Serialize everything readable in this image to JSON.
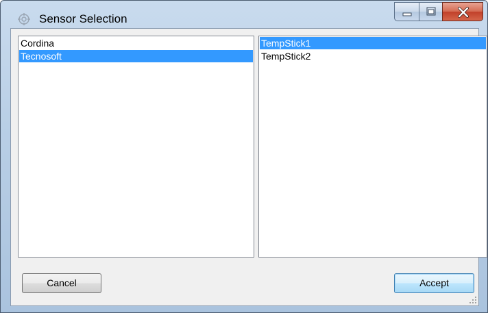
{
  "window": {
    "title": "Sensor Selection",
    "icon": "app-icon"
  },
  "caption_buttons": {
    "minimize_icon": "minimize-icon",
    "maximize_icon": "maximize-icon",
    "close_icon": "close-icon"
  },
  "manufacturers": {
    "items": [
      {
        "label": "Cordina",
        "selected": false
      },
      {
        "label": "Tecnosoft",
        "selected": true
      }
    ]
  },
  "sensors": {
    "items": [
      {
        "label": "TempStick1",
        "selected": true
      },
      {
        "label": "TempStick2",
        "selected": false
      }
    ]
  },
  "buttons": {
    "cancel_label": "Cancel",
    "accept_label": "Accept"
  },
  "colors": {
    "selection": "#3399ff",
    "close_button": "#c1402a"
  }
}
